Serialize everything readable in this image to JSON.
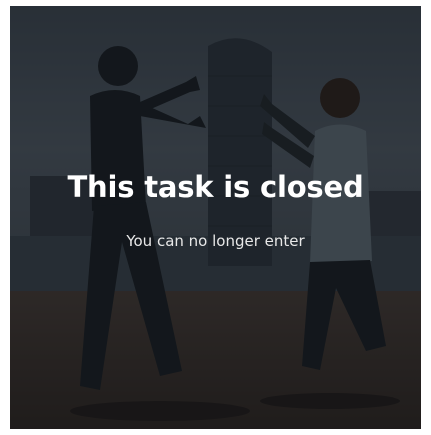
{
  "card": {
    "title": "This task is closed",
    "subtitle": "You can no longer enter"
  },
  "colors": {
    "overlay": "#0a0c10",
    "text": "#ffffff"
  }
}
